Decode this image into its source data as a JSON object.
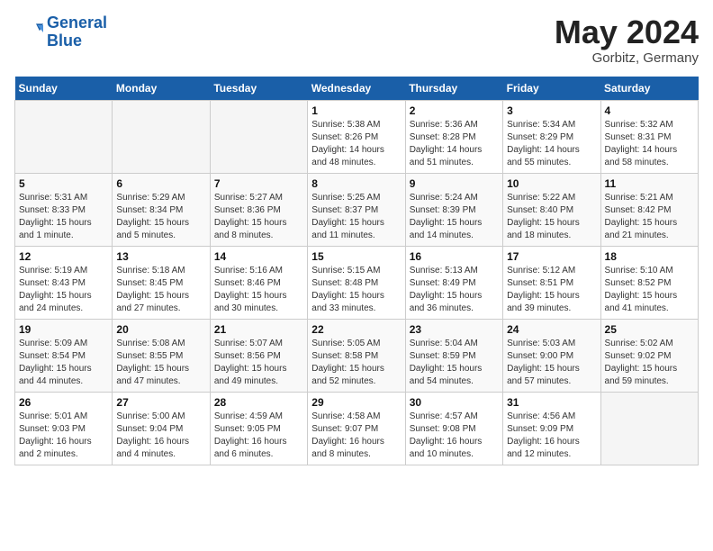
{
  "header": {
    "logo_line1": "General",
    "logo_line2": "Blue",
    "month": "May 2024",
    "location": "Gorbitz, Germany"
  },
  "weekdays": [
    "Sunday",
    "Monday",
    "Tuesday",
    "Wednesday",
    "Thursday",
    "Friday",
    "Saturday"
  ],
  "weeks": [
    [
      {
        "day": "",
        "sunrise": "",
        "sunset": "",
        "daylight": ""
      },
      {
        "day": "",
        "sunrise": "",
        "sunset": "",
        "daylight": ""
      },
      {
        "day": "",
        "sunrise": "",
        "sunset": "",
        "daylight": ""
      },
      {
        "day": "1",
        "sunrise": "Sunrise: 5:38 AM",
        "sunset": "Sunset: 8:26 PM",
        "daylight": "Daylight: 14 hours and 48 minutes."
      },
      {
        "day": "2",
        "sunrise": "Sunrise: 5:36 AM",
        "sunset": "Sunset: 8:28 PM",
        "daylight": "Daylight: 14 hours and 51 minutes."
      },
      {
        "day": "3",
        "sunrise": "Sunrise: 5:34 AM",
        "sunset": "Sunset: 8:29 PM",
        "daylight": "Daylight: 14 hours and 55 minutes."
      },
      {
        "day": "4",
        "sunrise": "Sunrise: 5:32 AM",
        "sunset": "Sunset: 8:31 PM",
        "daylight": "Daylight: 14 hours and 58 minutes."
      }
    ],
    [
      {
        "day": "5",
        "sunrise": "Sunrise: 5:31 AM",
        "sunset": "Sunset: 8:33 PM",
        "daylight": "Daylight: 15 hours and 1 minute."
      },
      {
        "day": "6",
        "sunrise": "Sunrise: 5:29 AM",
        "sunset": "Sunset: 8:34 PM",
        "daylight": "Daylight: 15 hours and 5 minutes."
      },
      {
        "day": "7",
        "sunrise": "Sunrise: 5:27 AM",
        "sunset": "Sunset: 8:36 PM",
        "daylight": "Daylight: 15 hours and 8 minutes."
      },
      {
        "day": "8",
        "sunrise": "Sunrise: 5:25 AM",
        "sunset": "Sunset: 8:37 PM",
        "daylight": "Daylight: 15 hours and 11 minutes."
      },
      {
        "day": "9",
        "sunrise": "Sunrise: 5:24 AM",
        "sunset": "Sunset: 8:39 PM",
        "daylight": "Daylight: 15 hours and 14 minutes."
      },
      {
        "day": "10",
        "sunrise": "Sunrise: 5:22 AM",
        "sunset": "Sunset: 8:40 PM",
        "daylight": "Daylight: 15 hours and 18 minutes."
      },
      {
        "day": "11",
        "sunrise": "Sunrise: 5:21 AM",
        "sunset": "Sunset: 8:42 PM",
        "daylight": "Daylight: 15 hours and 21 minutes."
      }
    ],
    [
      {
        "day": "12",
        "sunrise": "Sunrise: 5:19 AM",
        "sunset": "Sunset: 8:43 PM",
        "daylight": "Daylight: 15 hours and 24 minutes."
      },
      {
        "day": "13",
        "sunrise": "Sunrise: 5:18 AM",
        "sunset": "Sunset: 8:45 PM",
        "daylight": "Daylight: 15 hours and 27 minutes."
      },
      {
        "day": "14",
        "sunrise": "Sunrise: 5:16 AM",
        "sunset": "Sunset: 8:46 PM",
        "daylight": "Daylight: 15 hours and 30 minutes."
      },
      {
        "day": "15",
        "sunrise": "Sunrise: 5:15 AM",
        "sunset": "Sunset: 8:48 PM",
        "daylight": "Daylight: 15 hours and 33 minutes."
      },
      {
        "day": "16",
        "sunrise": "Sunrise: 5:13 AM",
        "sunset": "Sunset: 8:49 PM",
        "daylight": "Daylight: 15 hours and 36 minutes."
      },
      {
        "day": "17",
        "sunrise": "Sunrise: 5:12 AM",
        "sunset": "Sunset: 8:51 PM",
        "daylight": "Daylight: 15 hours and 39 minutes."
      },
      {
        "day": "18",
        "sunrise": "Sunrise: 5:10 AM",
        "sunset": "Sunset: 8:52 PM",
        "daylight": "Daylight: 15 hours and 41 minutes."
      }
    ],
    [
      {
        "day": "19",
        "sunrise": "Sunrise: 5:09 AM",
        "sunset": "Sunset: 8:54 PM",
        "daylight": "Daylight: 15 hours and 44 minutes."
      },
      {
        "day": "20",
        "sunrise": "Sunrise: 5:08 AM",
        "sunset": "Sunset: 8:55 PM",
        "daylight": "Daylight: 15 hours and 47 minutes."
      },
      {
        "day": "21",
        "sunrise": "Sunrise: 5:07 AM",
        "sunset": "Sunset: 8:56 PM",
        "daylight": "Daylight: 15 hours and 49 minutes."
      },
      {
        "day": "22",
        "sunrise": "Sunrise: 5:05 AM",
        "sunset": "Sunset: 8:58 PM",
        "daylight": "Daylight: 15 hours and 52 minutes."
      },
      {
        "day": "23",
        "sunrise": "Sunrise: 5:04 AM",
        "sunset": "Sunset: 8:59 PM",
        "daylight": "Daylight: 15 hours and 54 minutes."
      },
      {
        "day": "24",
        "sunrise": "Sunrise: 5:03 AM",
        "sunset": "Sunset: 9:00 PM",
        "daylight": "Daylight: 15 hours and 57 minutes."
      },
      {
        "day": "25",
        "sunrise": "Sunrise: 5:02 AM",
        "sunset": "Sunset: 9:02 PM",
        "daylight": "Daylight: 15 hours and 59 minutes."
      }
    ],
    [
      {
        "day": "26",
        "sunrise": "Sunrise: 5:01 AM",
        "sunset": "Sunset: 9:03 PM",
        "daylight": "Daylight: 16 hours and 2 minutes."
      },
      {
        "day": "27",
        "sunrise": "Sunrise: 5:00 AM",
        "sunset": "Sunset: 9:04 PM",
        "daylight": "Daylight: 16 hours and 4 minutes."
      },
      {
        "day": "28",
        "sunrise": "Sunrise: 4:59 AM",
        "sunset": "Sunset: 9:05 PM",
        "daylight": "Daylight: 16 hours and 6 minutes."
      },
      {
        "day": "29",
        "sunrise": "Sunrise: 4:58 AM",
        "sunset": "Sunset: 9:07 PM",
        "daylight": "Daylight: 16 hours and 8 minutes."
      },
      {
        "day": "30",
        "sunrise": "Sunrise: 4:57 AM",
        "sunset": "Sunset: 9:08 PM",
        "daylight": "Daylight: 16 hours and 10 minutes."
      },
      {
        "day": "31",
        "sunrise": "Sunrise: 4:56 AM",
        "sunset": "Sunset: 9:09 PM",
        "daylight": "Daylight: 16 hours and 12 minutes."
      },
      {
        "day": "",
        "sunrise": "",
        "sunset": "",
        "daylight": ""
      }
    ]
  ]
}
